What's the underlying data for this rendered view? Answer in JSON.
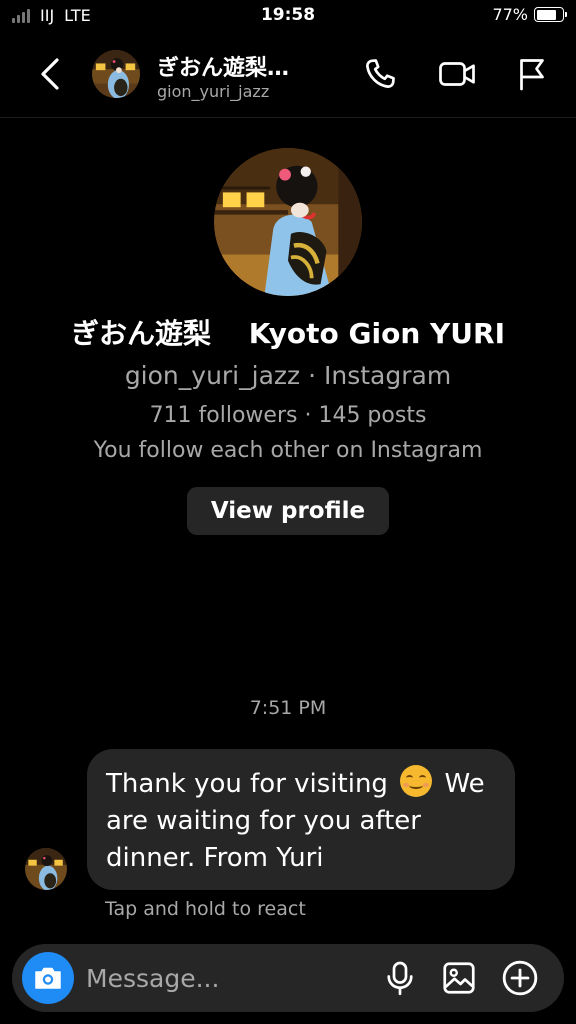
{
  "status_bar": {
    "carrier": "IIJ",
    "network": "LTE",
    "time": "19:58",
    "battery": "77%",
    "battery_level": 0.77
  },
  "header": {
    "display_name": "ぎおん遊梨…",
    "username": "gion_yuri_jazz",
    "icons": [
      "back-chevron-icon",
      "phone-icon",
      "video-camera-icon",
      "flag-icon"
    ]
  },
  "profile": {
    "name": "ぎおん遊梨　 Kyoto Gion YURI",
    "username_line": "gion_yuri_jazz · Instagram",
    "stats": "711 followers · 145 posts",
    "mutual": "You follow each other on Instagram",
    "view_profile_label": "View profile"
  },
  "thread": {
    "timestamp": "7:51 PM",
    "message_part1": "Thank you for visiting ",
    "message_emoji": "smiling-face-emoji",
    "message_part2": " We are waiting for you after dinner. From Yuri",
    "react_hint": "Tap and hold to react"
  },
  "composer": {
    "placeholder": "Message...",
    "icons": [
      "camera-icon",
      "microphone-icon",
      "gallery-icon",
      "plus-circle-icon"
    ],
    "accent_color": "#1f8bf5"
  }
}
